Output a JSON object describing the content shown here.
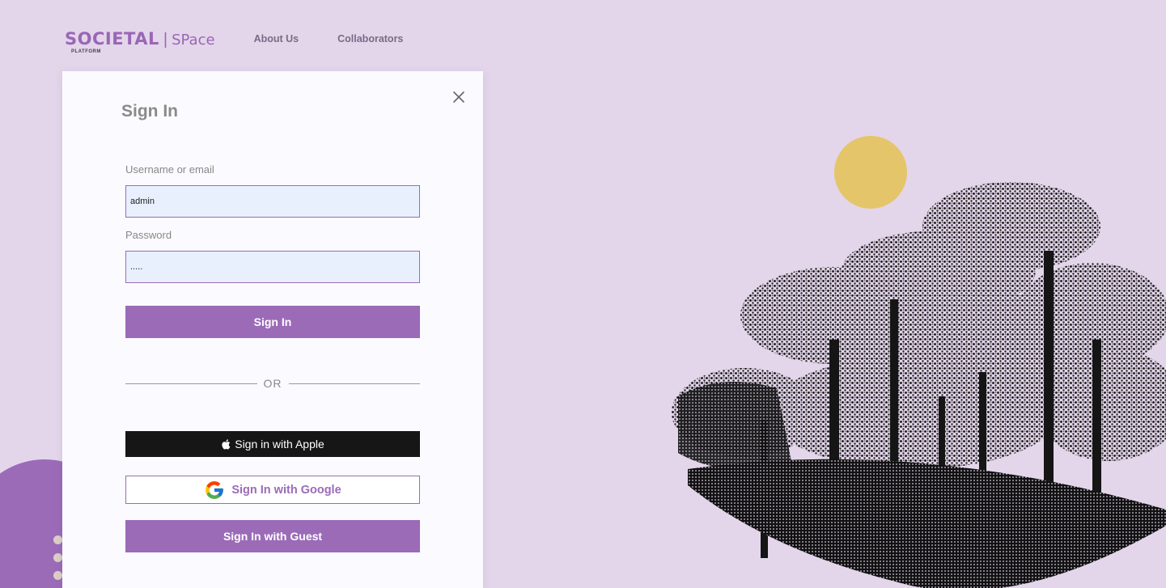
{
  "brand": {
    "name": "SOCIETAL",
    "sep": "|",
    "product": "SPace",
    "sub": "PLATFORM"
  },
  "nav": {
    "links": [
      "About Us",
      "Collaborators"
    ]
  },
  "signin": {
    "title": "Sign In",
    "username_label": "Username or email",
    "username_value": "admin",
    "password_label": "Password",
    "password_value": ".....",
    "submit_label": "Sign In",
    "or_label": "OR",
    "apple_label": "Sign in with Apple",
    "google_label": "Sign In with Google",
    "guest_label": "Sign In with Guest"
  },
  "icons": {
    "close": "close-icon",
    "apple": "apple-icon",
    "google": "google-icon"
  },
  "colors": {
    "background": "#e3d6ea",
    "accent": "#9b6bb8",
    "sun": "#e5c56a",
    "apple_button": "#161616"
  }
}
